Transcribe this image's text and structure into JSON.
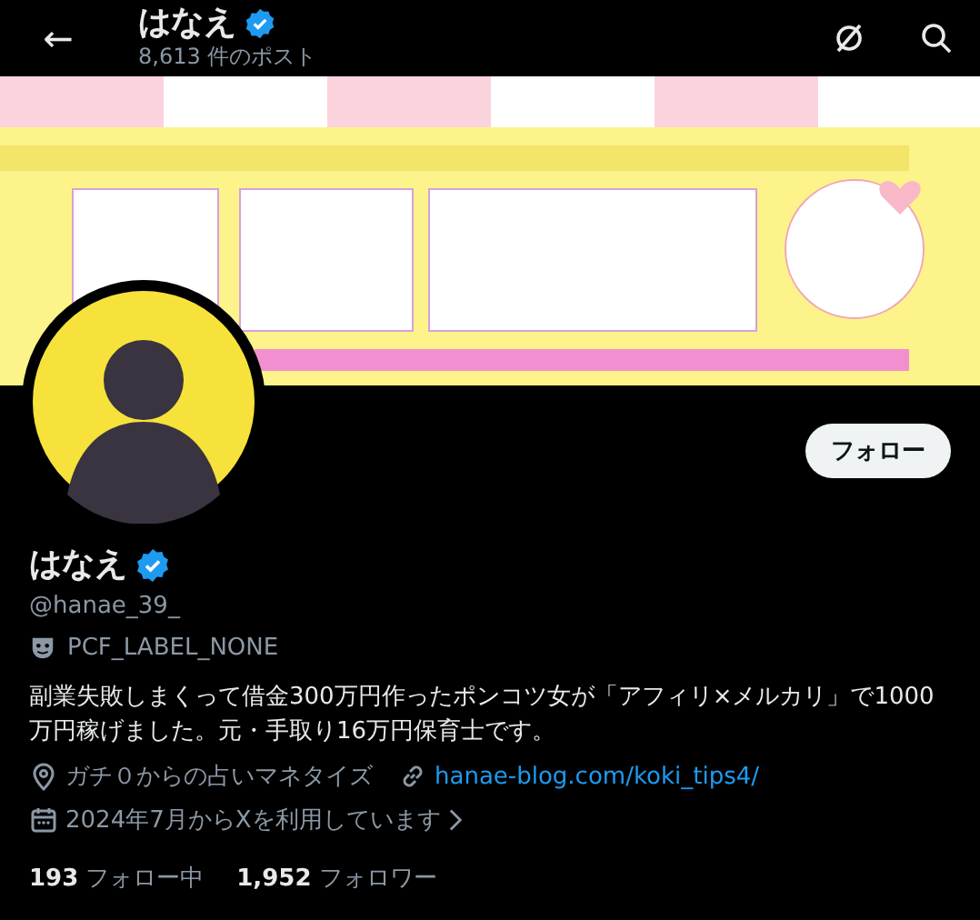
{
  "header": {
    "back": "←",
    "name": "はなえ",
    "verified": true,
    "post_count": "8,613 件のポスト"
  },
  "profile": {
    "follow_button": "フォロー",
    "name": "はなえ",
    "verified": true,
    "handle": "@hanae_39_",
    "label": "PCF_LABEL_NONE",
    "bio": "副業失敗しまくって借金300万円作ったポンコツ女が「アフィリ×メルカリ」で1000万円稼げました。元・手取り16万円保育士です。",
    "location": "ガチ０からの占いマネタイズ",
    "website": "hanae-blog.com/koki_tips4/",
    "joined": "2024年7月からXを利用しています",
    "stats": [
      {
        "count": "193",
        "label": "フォロー中"
      },
      {
        "count": "1,952",
        "label": "フォロワー"
      }
    ]
  }
}
